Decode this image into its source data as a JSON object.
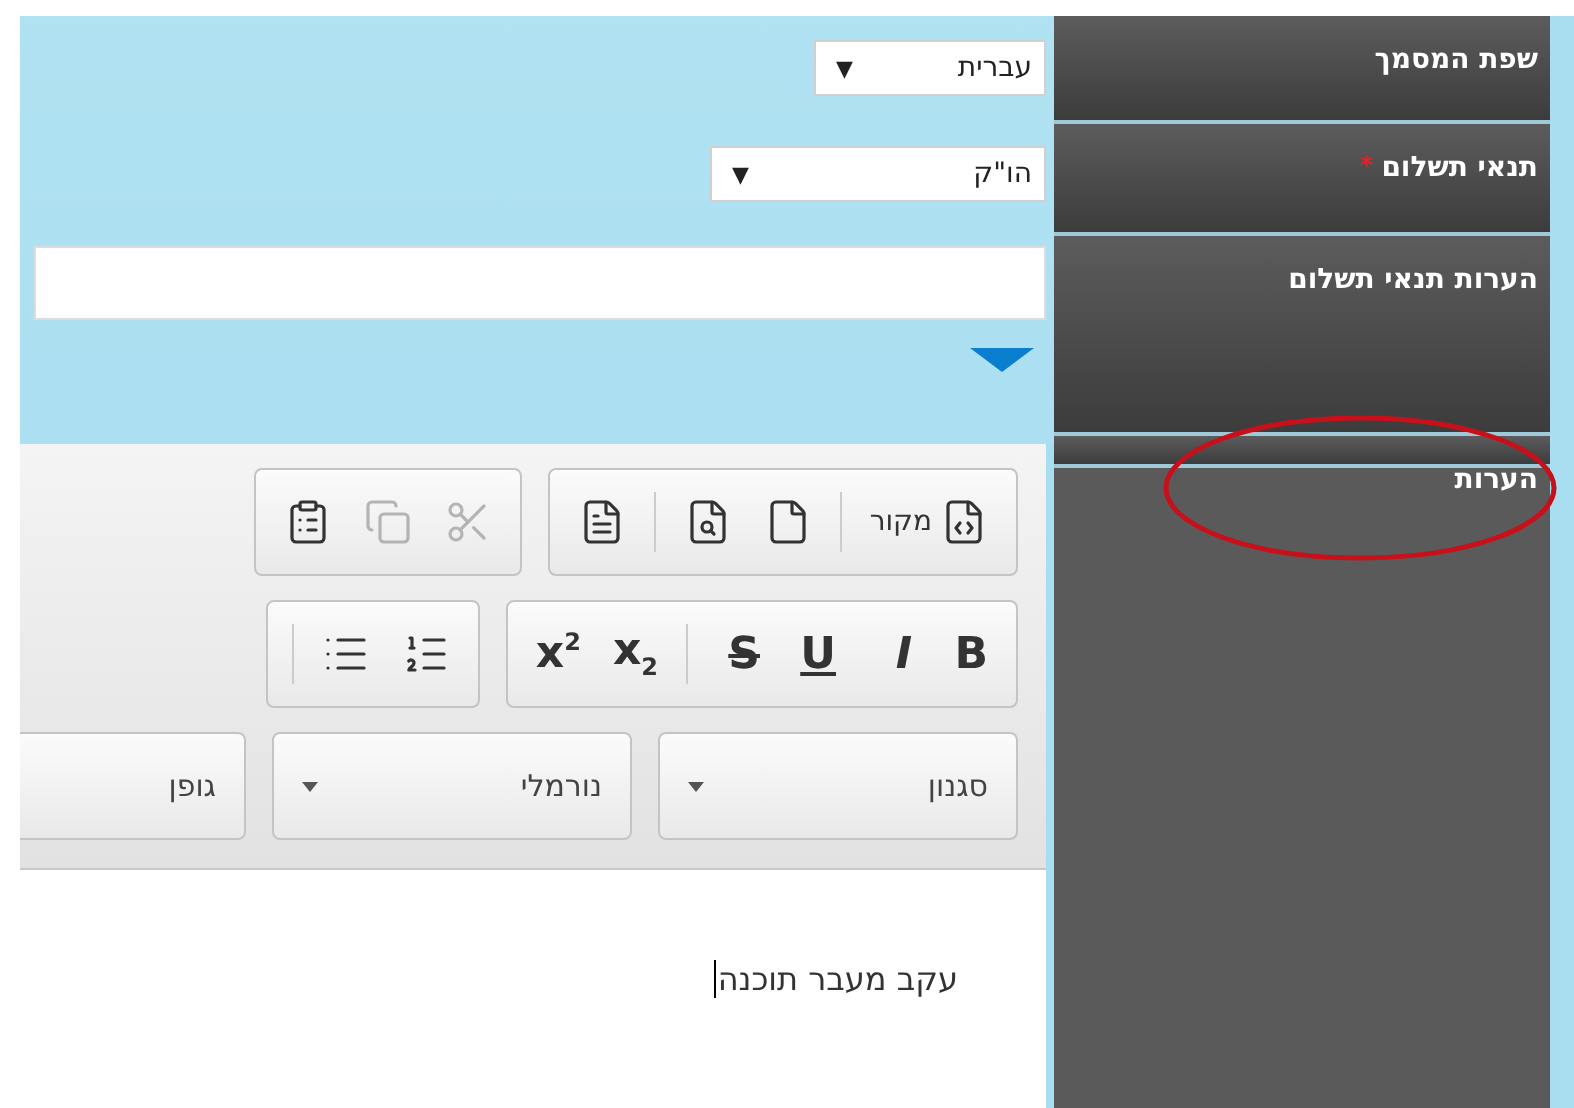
{
  "sidebar": {
    "items": [
      {
        "label": "שפת המסמך",
        "highlighted": false
      },
      {
        "label": "תנאי תשלום",
        "marker": "*",
        "highlighted": false
      },
      {
        "label": "הערות תנאי תשלום",
        "highlighted": false
      },
      {
        "label": "הערות",
        "highlighted": true
      }
    ]
  },
  "language_select": {
    "value": "עברית",
    "arrow": "▼"
  },
  "payment_select": {
    "value": "הו\"ק",
    "arrow": "▼"
  },
  "editor": {
    "toolbar_rows": [
      [
        [
          {
            "kind": "source",
            "label": "מקור",
            "disabled": false
          },
          {
            "kind": "separator"
          },
          {
            "kind": "new-page",
            "disabled": false
          },
          {
            "kind": "preview",
            "disabled": false
          },
          {
            "kind": "separator"
          },
          {
            "kind": "template",
            "disabled": false
          }
        ],
        [
          {
            "kind": "cut",
            "disabled": true
          },
          {
            "kind": "copy",
            "disabled": true
          },
          {
            "kind": "paste",
            "disabled": false
          }
        ]
      ],
      [
        [
          {
            "kind": "bold",
            "label": "B",
            "disabled": false
          },
          {
            "kind": "italic",
            "label": "I",
            "disabled": false
          },
          {
            "kind": "underline",
            "label": "U",
            "disabled": false
          },
          {
            "kind": "strike",
            "label": "S",
            "disabled": false
          },
          {
            "kind": "separator"
          },
          {
            "kind": "subscript",
            "label": "x$_{2}$",
            "disabled": false
          },
          {
            "kind": "superscript",
            "label": "x$^{2}$",
            "disabled": false
          }
        ],
        [
          {
            "kind": "numbered-list",
            "disabled": false
          },
          {
            "kind": "bulleted-list",
            "disabled": false
          },
          {
            "kind": "separator"
          }
        ]
      ]
    ],
    "combos": [
      {
        "label": "סגנון",
        "has_arrow": true
      },
      {
        "label": "נורמלי",
        "has_arrow": true
      },
      {
        "label": "גופן",
        "has_arrow": false
      }
    ],
    "body_text": "עקב מעבר תוכנה"
  }
}
